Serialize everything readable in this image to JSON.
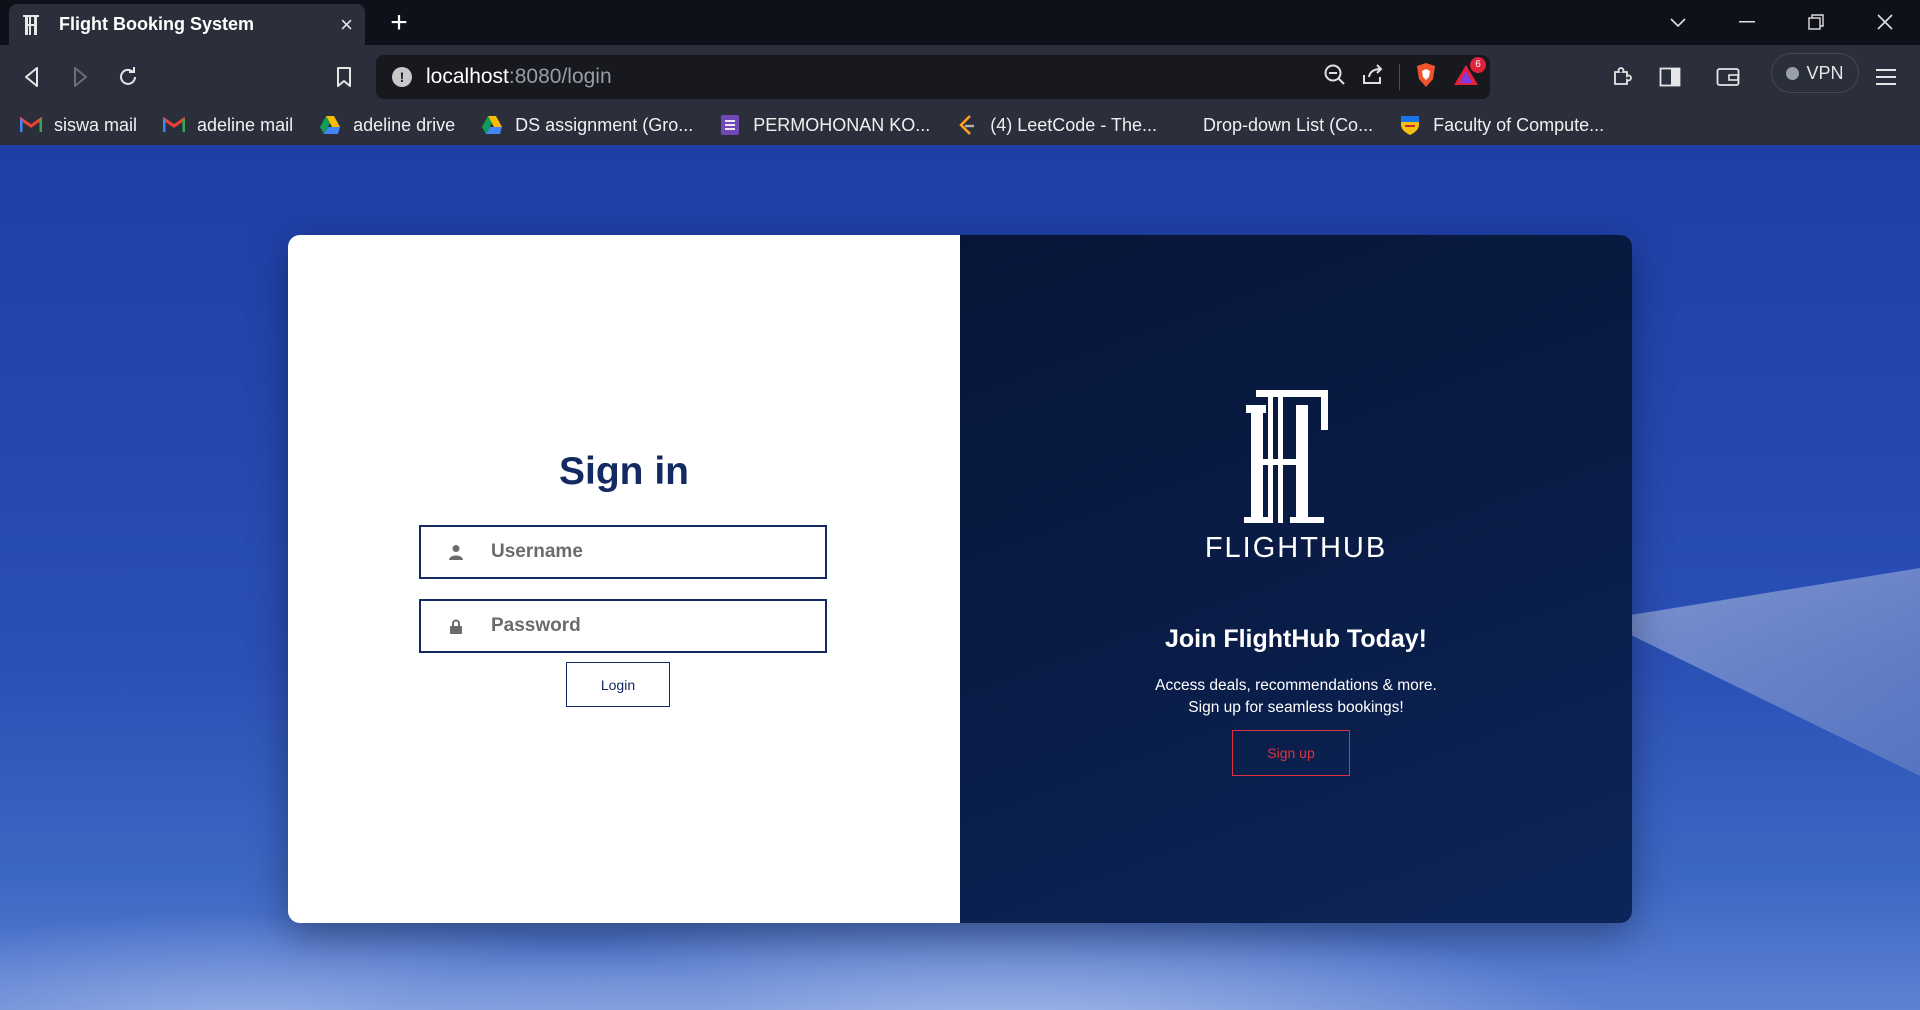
{
  "browser": {
    "tab_title": "Flight Booking System",
    "tab_close": "×",
    "new_tab": "+",
    "url_host": "localhost",
    "url_path": ":8080/login",
    "shield_badge_count": "6",
    "vpn_label": "VPN"
  },
  "bookmarks": [
    {
      "label": "siswa mail",
      "icon": "gmail-icon"
    },
    {
      "label": "adeline mail",
      "icon": "gmail-icon"
    },
    {
      "label": "adeline drive",
      "icon": "drive-icon"
    },
    {
      "label": "DS assignment (Gro...",
      "icon": "drive-icon"
    },
    {
      "label": "PERMOHONAN KO...",
      "icon": "forms-icon"
    },
    {
      "label": "(4) LeetCode - The...",
      "icon": "leetcode-icon"
    },
    {
      "label": "Drop-down List (Co...",
      "icon": ""
    },
    {
      "label": "Faculty of Compute...",
      "icon": "faculty-crest-icon"
    }
  ],
  "signin": {
    "title": "Sign in",
    "username_placeholder": "Username",
    "password_placeholder": "Password",
    "login_label": "Login"
  },
  "promo": {
    "logo_text": "FLIGHTHUB",
    "title": "Join FlightHub Today!",
    "line1": "Access deals, recommendations & more.",
    "line2": "Sign up for seamless bookings!",
    "signup_label": "Sign up"
  },
  "colors": {
    "primary_navy": "#142a63",
    "panel_dark": "#071638",
    "accent_red": "#e0323e"
  }
}
